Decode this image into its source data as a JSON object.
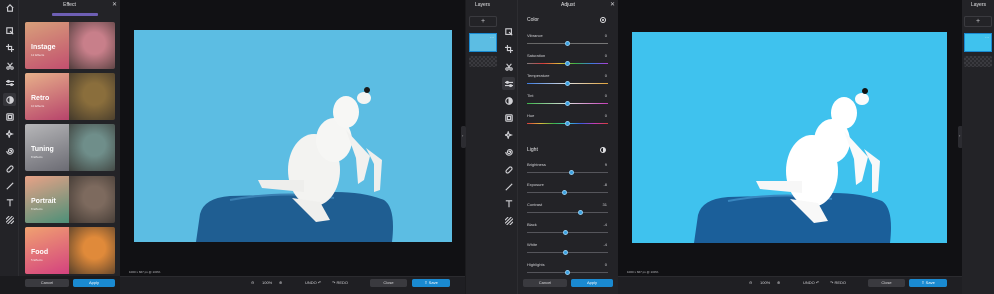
{
  "left_editor": {
    "effect_panel": {
      "title": "Effect",
      "cards": [
        {
          "name": "Instage",
          "count": "12 Effects",
          "gradient": [
            "#d8a07a",
            "#c24f6f"
          ],
          "photo_color": "#c87f8a"
        },
        {
          "name": "Retro",
          "count": "10 Effects",
          "gradient": [
            "#e7b18a",
            "#b7436b"
          ],
          "photo_color": "#8a6e3c"
        },
        {
          "name": "Tuning",
          "count": "8 Effects",
          "gradient": [
            "#b7b7b9",
            "#6b6b73"
          ],
          "photo_color": "#6f8e8a"
        },
        {
          "name": "Portrait",
          "count": "8 Effects",
          "gradient": [
            "#e9a287",
            "#4c9078"
          ],
          "photo_color": "#7d6a5e"
        },
        {
          "name": "Food",
          "count": "5 Effects",
          "gradient": [
            "#f0a270",
            "#d4417f"
          ],
          "photo_color": "#e08a3a"
        }
      ],
      "cancel_label": "Cancel",
      "apply_label": "Apply"
    },
    "image_dimensions": "1000 x 667 px @ 100%"
  },
  "right_editor": {
    "adjust_panel": {
      "title": "Adjust",
      "color_section": "Color",
      "color_sliders": [
        {
          "label": "Vibrance",
          "value": "0",
          "pos": 0.5
        },
        {
          "label": "Saturation",
          "value": "0",
          "pos": 0.5
        },
        {
          "label": "Temperature",
          "value": "0",
          "pos": 0.5
        },
        {
          "label": "Tint",
          "value": "0",
          "pos": 0.5
        },
        {
          "label": "Hue",
          "value": "0",
          "pos": 0.5
        }
      ],
      "light_section": "Light",
      "light_sliders": [
        {
          "label": "Brightness",
          "value": "9",
          "pos": 0.55
        },
        {
          "label": "Exposure",
          "value": "-8",
          "pos": 0.46
        },
        {
          "label": "Contrast",
          "value": "31",
          "pos": 0.66
        },
        {
          "label": "Black",
          "value": "-4",
          "pos": 0.48
        },
        {
          "label": "White",
          "value": "-4",
          "pos": 0.48
        },
        {
          "label": "Highlights",
          "value": "0",
          "pos": 0.5
        }
      ],
      "cancel_label": "Cancel",
      "apply_label": "Apply"
    },
    "image_dimensions": "1000 x 667 px @ 100%"
  },
  "footer": {
    "zoom": "100%",
    "undo_label": "UNDO",
    "redo_label": "REDO",
    "close_label": "Close",
    "save_label": "Save"
  },
  "layers": {
    "title": "Layers",
    "add_symbol": "+"
  },
  "colors": {
    "accent": "#1a8ad1",
    "photo_bg": "#5cbde3",
    "photo_bg_right": "#3fc2ee",
    "panel": "#232327"
  }
}
